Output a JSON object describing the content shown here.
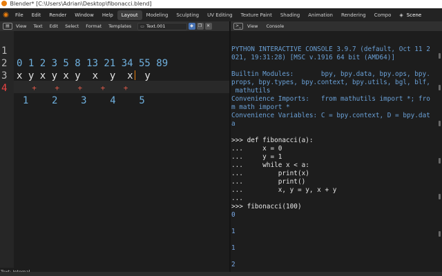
{
  "window": {
    "title": "Blender* [C:\\Users\\Adrian\\Desktop\\fibonacci.blend]"
  },
  "topbar": {
    "menus": [
      "File",
      "Edit",
      "Render",
      "Window",
      "Help"
    ],
    "workspaces": [
      "Layout",
      "Modeling",
      "Sculpting",
      "UV Editing",
      "Texture Paint",
      "Shading",
      "Animation",
      "Rendering",
      "Compo"
    ],
    "active_workspace": "Layout",
    "scene_label": "Scene"
  },
  "text_editor": {
    "editor_type_icon": "text-editor-icon",
    "menus": [
      "View",
      "Text",
      "Edit",
      "Select",
      "Format",
      "Templates"
    ],
    "text_name": "Text.001",
    "footer": "Text: Internal",
    "lines": [
      {
        "number": "1",
        "content": "0 1 2 3 5 8 13 21 34 55 89"
      },
      {
        "number": "2",
        "content": "x y x y x y  x  y  x  y"
      },
      {
        "number": "3",
        "content": "  +    +    +    +    +"
      },
      {
        "number": "4",
        "content": "  1    2    3    4    5"
      }
    ],
    "current_line": "4"
  },
  "console": {
    "editor_type_icon": "console-icon",
    "menus": [
      "View",
      "Console"
    ],
    "lines": [
      {
        "kind": "info",
        "text": "PYTHON INTERACTIVE CONSOLE 3.9.7 (default, Oct 11 2"
      },
      {
        "kind": "info",
        "text": "021, 19:31:28) [MSC v.1916 64 bit (AMD64)]"
      },
      {
        "kind": "blank",
        "text": ""
      },
      {
        "kind": "info",
        "text": "Builtin Modules:       bpy, bpy.data, bpy.ops, bpy."
      },
      {
        "kind": "info",
        "text": "props, bpy.types, bpy.context, bpy.utils, bgl, blf,"
      },
      {
        "kind": "info",
        "text": " mathutils"
      },
      {
        "kind": "info",
        "text": "Convenience Imports:   from mathutils import *; fro"
      },
      {
        "kind": "info",
        "text": "m math import *"
      },
      {
        "kind": "info",
        "text": "Convenience Variables: C = bpy.context, D = bpy.dat"
      },
      {
        "kind": "info",
        "text": "a"
      },
      {
        "kind": "blank",
        "text": ""
      },
      {
        "kind": "in",
        "text": ">>> def fibonacci(a):"
      },
      {
        "kind": "in",
        "text": "...     x = 0"
      },
      {
        "kind": "in",
        "text": "...     y = 1"
      },
      {
        "kind": "in",
        "text": "...     while x < a:"
      },
      {
        "kind": "in",
        "text": "...         print(x)"
      },
      {
        "kind": "in",
        "text": "...         print()"
      },
      {
        "kind": "in",
        "text": "...         x, y = y, x + y"
      },
      {
        "kind": "in",
        "text": "..."
      },
      {
        "kind": "in",
        "text": ">>> fibonacci(100)"
      },
      {
        "kind": "out",
        "text": "0"
      },
      {
        "kind": "blank",
        "text": ""
      },
      {
        "kind": "out",
        "text": "1"
      },
      {
        "kind": "blank",
        "text": ""
      },
      {
        "kind": "out",
        "text": "1"
      },
      {
        "kind": "blank",
        "text": ""
      },
      {
        "kind": "out",
        "text": "2"
      }
    ]
  },
  "colors": {
    "accent": "#e87d0d",
    "number": "#6fb0de",
    "operator": "#e25a4a",
    "console_info": "#6aa0d6",
    "console_output": "#78a8e4"
  }
}
